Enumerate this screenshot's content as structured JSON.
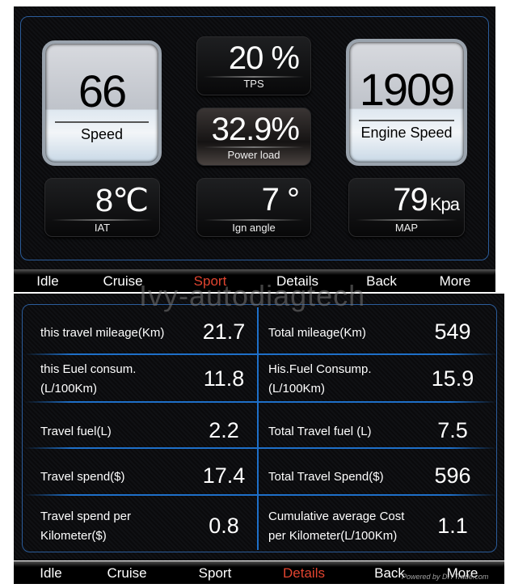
{
  "dashboard": {
    "speed": {
      "value": "66",
      "label": "Speed"
    },
    "engine_speed": {
      "value": "1909",
      "label": "Engine Speed"
    },
    "tps": {
      "value": "20 %",
      "label": "TPS"
    },
    "power_load": {
      "value": "32.9%",
      "label": "Power load"
    },
    "iat": {
      "value": "8℃",
      "label": "IAT"
    },
    "ign_angle": {
      "value": "7 °",
      "label": "Ign angle"
    },
    "map": {
      "value": "79",
      "unit": "Kpa",
      "label": "MAP"
    }
  },
  "nav_top": {
    "items": [
      "Idle",
      "Cruise",
      "Sport",
      "Details",
      "Back",
      "More"
    ],
    "active": "Sport"
  },
  "details": {
    "left": [
      {
        "label1": "this travel mileage(Km)",
        "label2": "",
        "value": "21.7"
      },
      {
        "label1": "this Euel consum.",
        "label2": "(L/100Km)",
        "value": "11.8"
      },
      {
        "label1": "Travel fuel(L)",
        "label2": "",
        "value": "2.2"
      },
      {
        "label1": "Travel spend($)",
        "label2": "",
        "value": "17.4"
      },
      {
        "label1": "Travel spend per",
        "label2": "Kilometer($)",
        "value": "0.8"
      }
    ],
    "right": [
      {
        "label1": "Total mileage(Km)",
        "label2": "",
        "value": "549"
      },
      {
        "label1": "His.Fuel Consump.",
        "label2": "(L/100Km)",
        "value": "15.9"
      },
      {
        "label1": "Total Travel fuel (L)",
        "label2": "",
        "value": "7.5"
      },
      {
        "label1": "Total Travel Spend($)",
        "label2": "",
        "value": "596"
      },
      {
        "label1": "Cumulative average Cost",
        "label2": "per Kilometer(L/100Km)",
        "value": "1.1"
      }
    ]
  },
  "nav_bottom": {
    "items": [
      "Idle",
      "Cruise",
      "Sport",
      "Details",
      "Back",
      "More"
    ],
    "active": "Details"
  },
  "watermarks": {
    "main": "Ivy-autodiagtech",
    "footer": "Powered by DIYTrade.com"
  },
  "colors": {
    "accent": "#e0442f",
    "frame": "#2b5c9a",
    "divider": "#1e6fc8"
  }
}
